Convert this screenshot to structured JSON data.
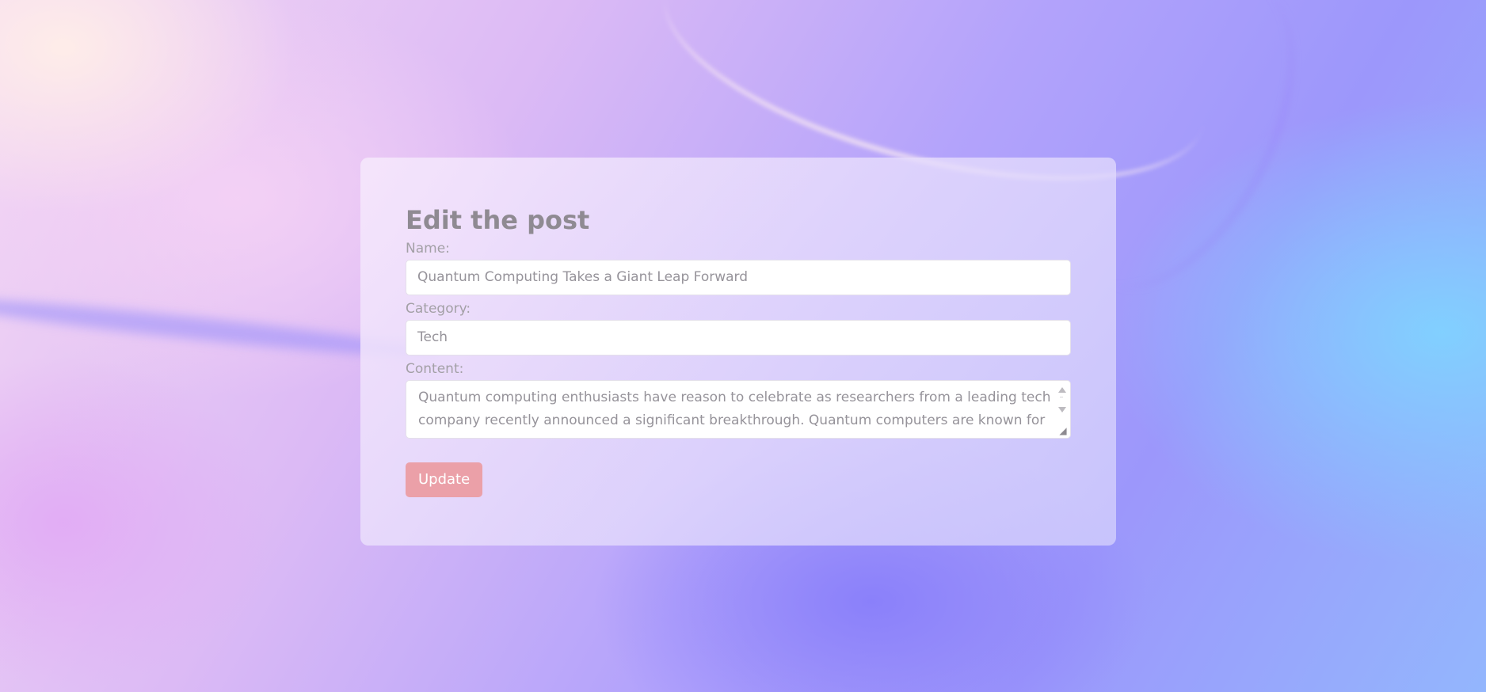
{
  "form": {
    "title": "Edit the post",
    "name_label": "Name:",
    "name_value": "Quantum Computing Takes a Giant Leap Forward",
    "category_label": "Category:",
    "category_value": "Tech",
    "content_label": "Content:",
    "content_value": "Quantum computing enthusiasts have reason to celebrate as researchers from a leading tech company recently announced a significant breakthrough. Quantum computers are known for",
    "update_label": "Update"
  },
  "icons": {
    "scroll_up": "triangle-up-icon",
    "scroll_down": "triangle-down-icon",
    "resize": "resize-grip-icon"
  },
  "colors": {
    "button": "#eba0a8",
    "title": "#8f8a92"
  }
}
